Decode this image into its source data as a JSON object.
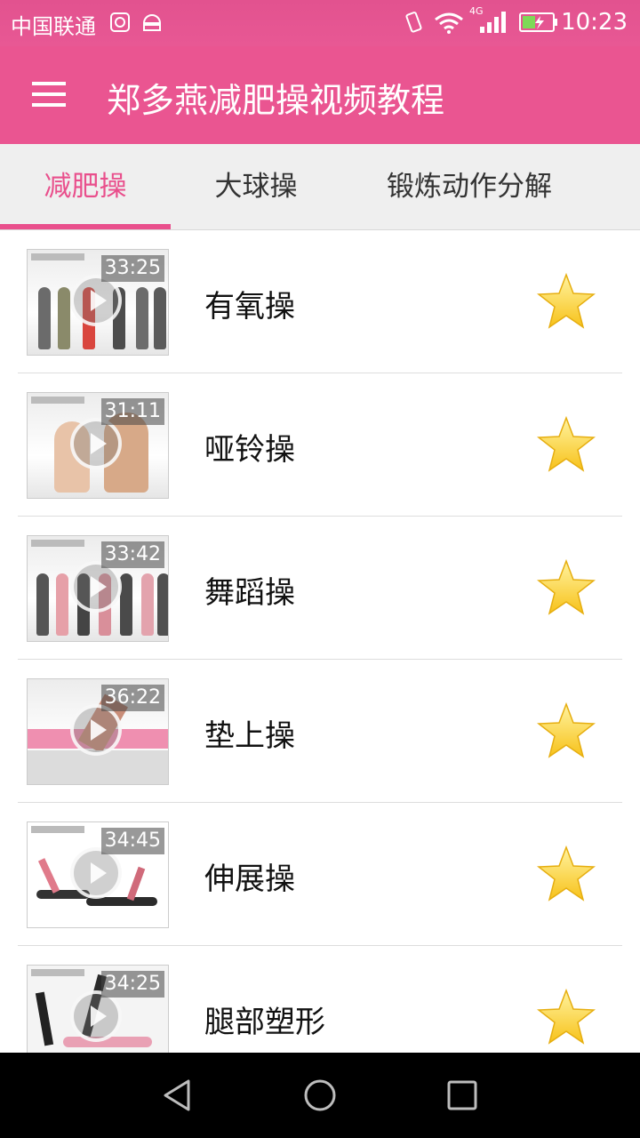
{
  "status_bar": {
    "carrier": "中国联通",
    "network": "4G",
    "time": "10:23",
    "icons": [
      "sim-icon",
      "android-icon",
      "vibrate-icon",
      "wifi-icon",
      "signal-icon",
      "battery-icon"
    ]
  },
  "app_bar": {
    "title": "郑多燕减肥操视频教程",
    "menu_icon": "hamburger-menu-icon",
    "color": "#ea5591"
  },
  "tabs": [
    {
      "label": "减肥操",
      "active": true
    },
    {
      "label": "大球操",
      "active": false
    },
    {
      "label": "锻炼动作分解",
      "active": false
    }
  ],
  "videos": [
    {
      "title": "有氧操",
      "duration": "33:25",
      "star_icon": "star-icon"
    },
    {
      "title": "哑铃操",
      "duration": "31:11",
      "star_icon": "star-icon"
    },
    {
      "title": "舞蹈操",
      "duration": "33:42",
      "star_icon": "star-icon"
    },
    {
      "title": "垫上操",
      "duration": "36:22",
      "star_icon": "star-icon"
    },
    {
      "title": "伸展操",
      "duration": "34:45",
      "star_icon": "star-icon"
    },
    {
      "title": "腿部塑形",
      "duration": "34:25",
      "star_icon": "star-icon"
    }
  ],
  "nav_bar": {
    "icons": [
      "back-icon",
      "home-icon",
      "recents-icon"
    ]
  },
  "colors": {
    "accent": "#e94f8c",
    "star": "#fbd33a"
  }
}
